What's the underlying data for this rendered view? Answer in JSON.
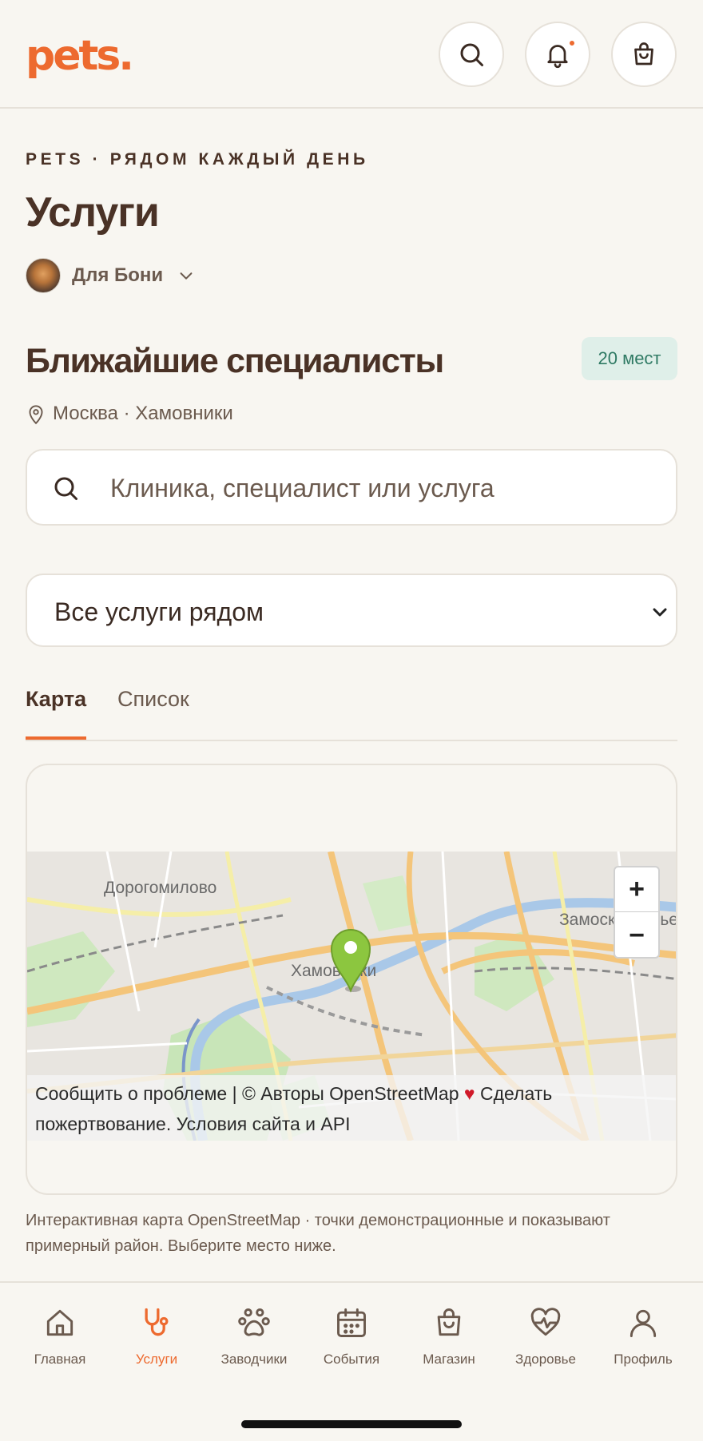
{
  "header": {
    "logo": "pets.",
    "buttons": [
      {
        "name": "search-icon"
      },
      {
        "name": "bell-icon",
        "has_dot": true
      },
      {
        "name": "shopping-bag-icon"
      }
    ]
  },
  "page": {
    "eyebrow": "PETS · РЯДОМ КАЖДЫЙ ДЕНЬ",
    "title": "Услуги",
    "pet_selector": "Для Бони"
  },
  "nearby": {
    "title": "Ближайшие специалисты",
    "count_badge": "20 мест",
    "location": "Москва · Хамовники"
  },
  "search": {
    "placeholder": "Клиника, специалист или услуга"
  },
  "filter": {
    "selected": "Все услуги рядом"
  },
  "tabs": {
    "map": "Карта",
    "list": "Список",
    "active": "map"
  },
  "map": {
    "places": [
      "Дорогомилово",
      "Хамовники",
      "Замоскворечье"
    ],
    "zoom_in": "+",
    "zoom_out": "−",
    "attribution": "Сообщить о проблеме | © Авторы OpenStreetMap ♥ Сделать пожертвование. Условия сайта и API",
    "attribution_parts": {
      "report": "Сообщить о проблеме | © Авторы OpenStreetMap",
      "heart": "♥",
      "donate": " Сделать пожертвование. Условия сайта и API"
    },
    "note": "Интерактивная карта OpenStreetMap · точки демонстрационные и показывают примерный район. Выберите место ниже."
  },
  "nav": {
    "items": [
      {
        "label": "Главная",
        "icon": "home-icon"
      },
      {
        "label": "Услуги",
        "icon": "stethoscope-icon",
        "active": true
      },
      {
        "label": "Заводчики",
        "icon": "paw-icon"
      },
      {
        "label": "События",
        "icon": "calendar-icon"
      },
      {
        "label": "Магазин",
        "icon": "shopping-bag-icon"
      },
      {
        "label": "Здоровье",
        "icon": "heart-pulse-icon"
      },
      {
        "label": "Профиль",
        "icon": "user-icon"
      }
    ]
  },
  "colors": {
    "accent": "#ed6a2f",
    "text": "#4a3226",
    "muted": "#6b5a4e",
    "badge_bg": "#dfefe9",
    "badge_text": "#2f7a64",
    "pin": "#8cc63f"
  }
}
